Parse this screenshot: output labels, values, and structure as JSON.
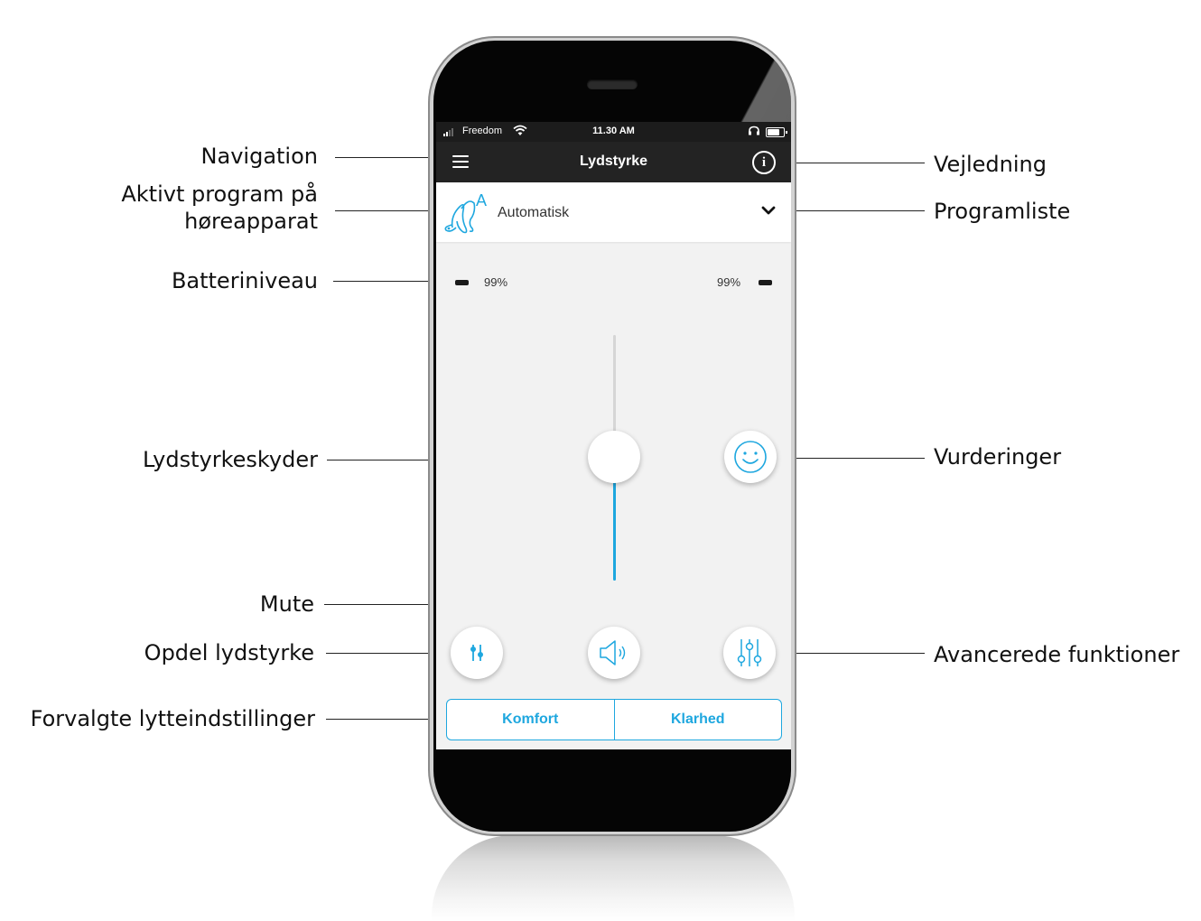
{
  "annotations": {
    "navigation": "Navigation",
    "active_program_line1": "Aktivt program på",
    "active_program_line2": "høreapparat",
    "battery_level": "Batteriniveau",
    "volume_slider": "Lydstyrkeskyder",
    "mute": "Mute",
    "split_volume": "Opdel lydstyrke",
    "preset_settings": "Forvalgte lytteindstillinger",
    "guide": "Vejledning",
    "program_list": "Programliste",
    "ratings": "Vurderinger",
    "advanced_functions": "Avancerede funktioner"
  },
  "status_bar": {
    "carrier": "Freedom",
    "time": "11.30 AM"
  },
  "header": {
    "title": "Lydstyrke"
  },
  "program": {
    "name": "Automatisk",
    "badge": "A"
  },
  "battery": {
    "left": "99%",
    "right": "99%"
  },
  "volume": {
    "level": 0.44
  },
  "presets": {
    "comfort": "Komfort",
    "clarity": "Klarhed"
  },
  "colors": {
    "accent": "#1ea7df",
    "header_bg": "#232323",
    "screen_bg": "#f2f2f2"
  },
  "icons": {
    "menu": "hamburger-icon",
    "info": "info-icon",
    "chevron": "chevron-down-icon",
    "hearing_aid": "hearing-aid-icon",
    "smiley": "smiley-icon",
    "speaker": "speaker-icon",
    "split": "split-sliders-icon",
    "equalizer": "equalizer-icon"
  }
}
